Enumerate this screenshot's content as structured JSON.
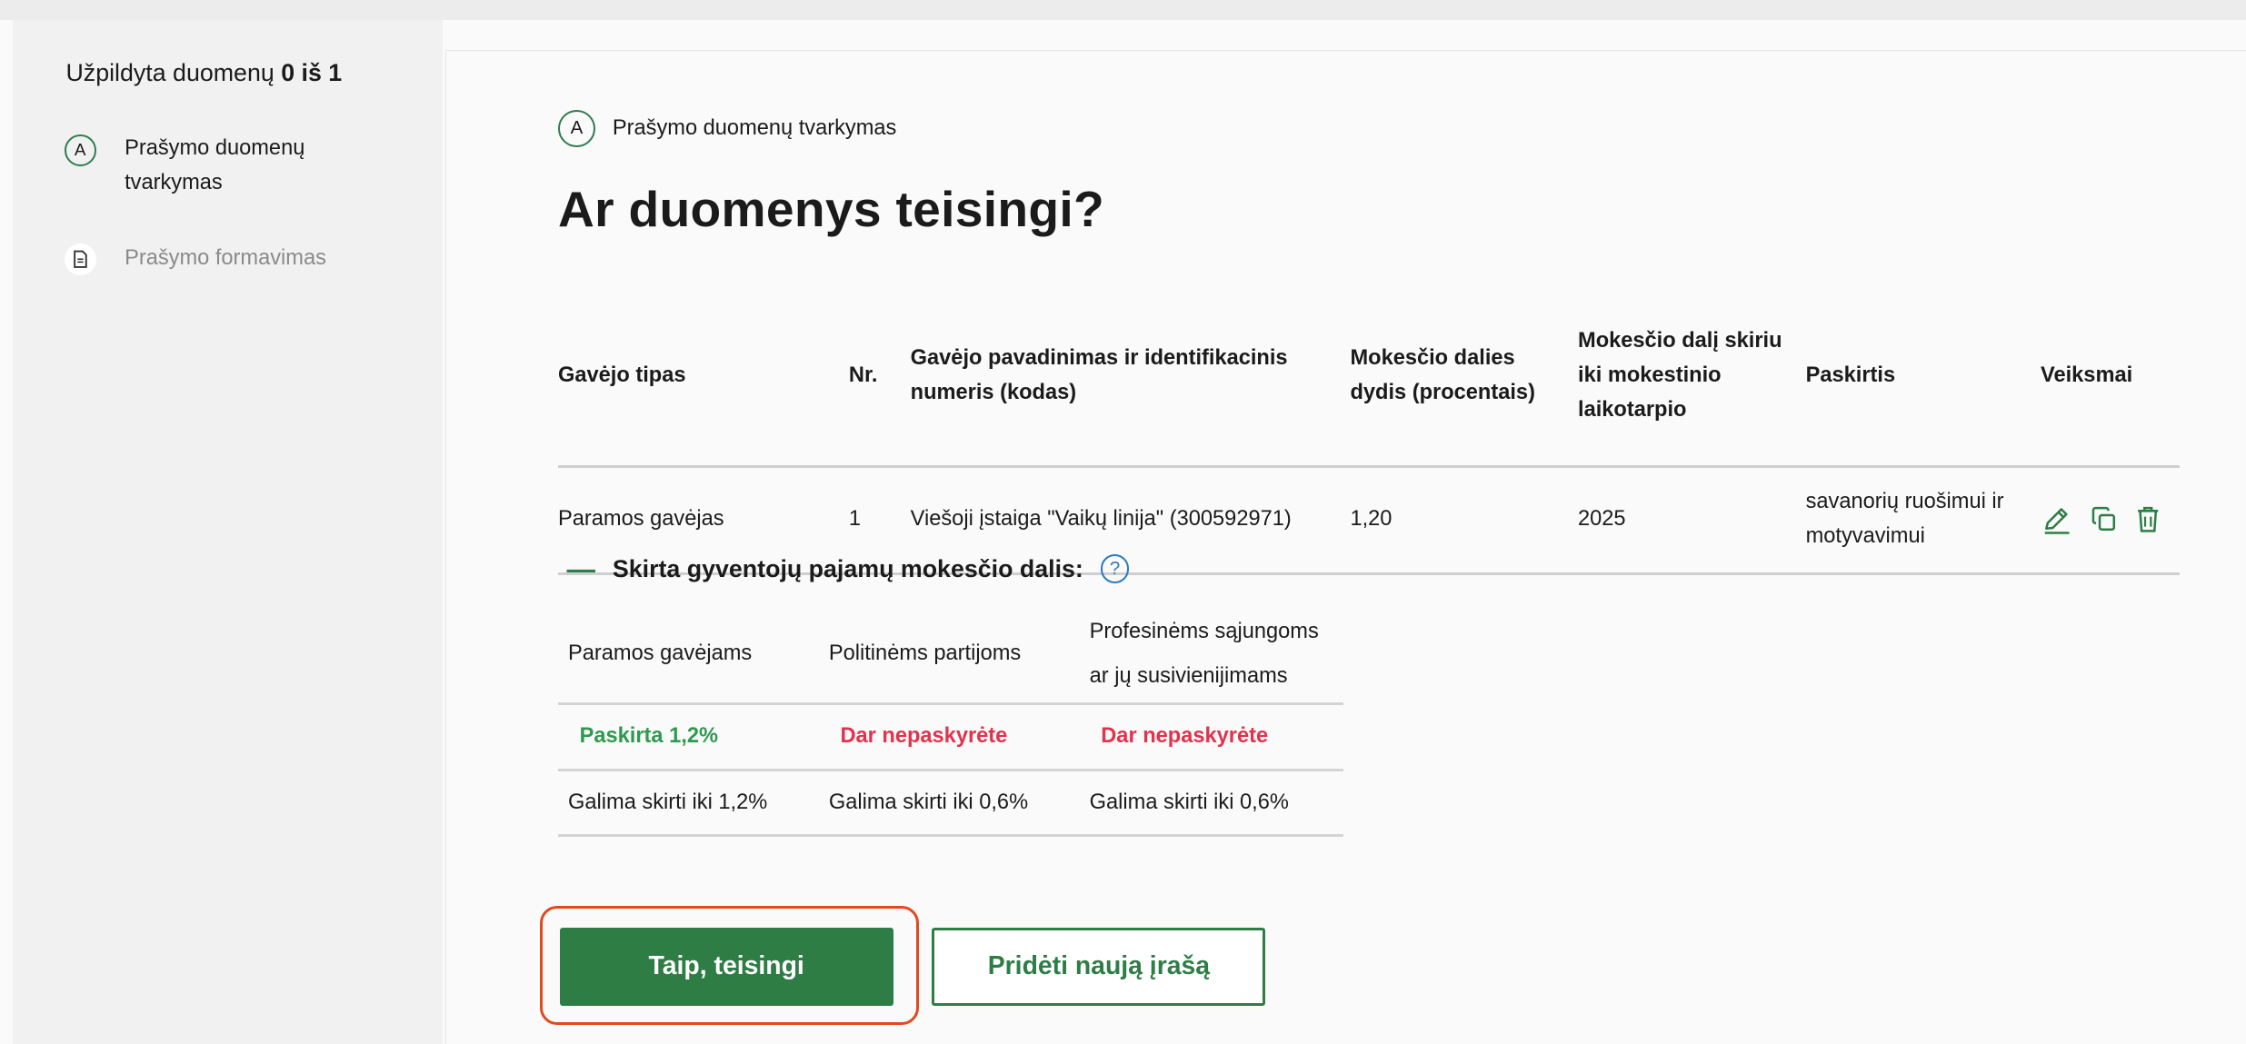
{
  "sidebar": {
    "progress_prefix": "Užpildyta duomenų",
    "progress_count": "0 iš 1",
    "steps": [
      {
        "badge": "A",
        "label": "Prašymo duomenų tvarkymas"
      },
      {
        "icon": "document-icon",
        "label": "Prašymo formavimas"
      }
    ]
  },
  "breadcrumb": {
    "badge": "A",
    "label": "Prašymo duomenų tvarkymas"
  },
  "page_title": "Ar duomenys teisingi?",
  "table": {
    "headers": [
      "Gavėjo tipas",
      "Nr.",
      "Gavėjo pavadinimas ir identifikacinis numeris (kodas)",
      "Mokesčio dalies dydis (procentais)",
      "Mokesčio dalį skiriu iki mokestinio laikotarpio",
      "Paskirtis",
      "Veiksmai"
    ],
    "rows": [
      {
        "type": "Paramos gavėjas",
        "nr": "1",
        "name": "Viešoji įstaiga \"Vaikų linija\" (300592971)",
        "percent": "1,20",
        "until": "2025",
        "purpose": "savanorių ruošimui ir motyvavimui"
      }
    ]
  },
  "summary": {
    "title": "Skirta gyventojų pajamų mokesčio dalis:",
    "columns": [
      "Paramos gavėjams",
      "Politinėms partijoms",
      "Profesinėms sąjungoms ar jų susivienijimams"
    ],
    "status": [
      "Paskirta 1,2%",
      "Dar nepaskyrėte",
      "Dar nepaskyrėte"
    ],
    "limits": [
      "Galima skirti iki 1,2%",
      "Galima skirti iki 0,6%",
      "Galima skirti iki 0,6%"
    ]
  },
  "buttons": {
    "confirm": "Taip, teisingi",
    "add_new": "Pridėti naują įrašą"
  },
  "colors": {
    "accent_green": "#2e7d45",
    "status_green": "#2e9a4f",
    "status_red": "#e0334d",
    "focus_ring": "#e04a1f",
    "help_blue": "#2b7bbf"
  }
}
